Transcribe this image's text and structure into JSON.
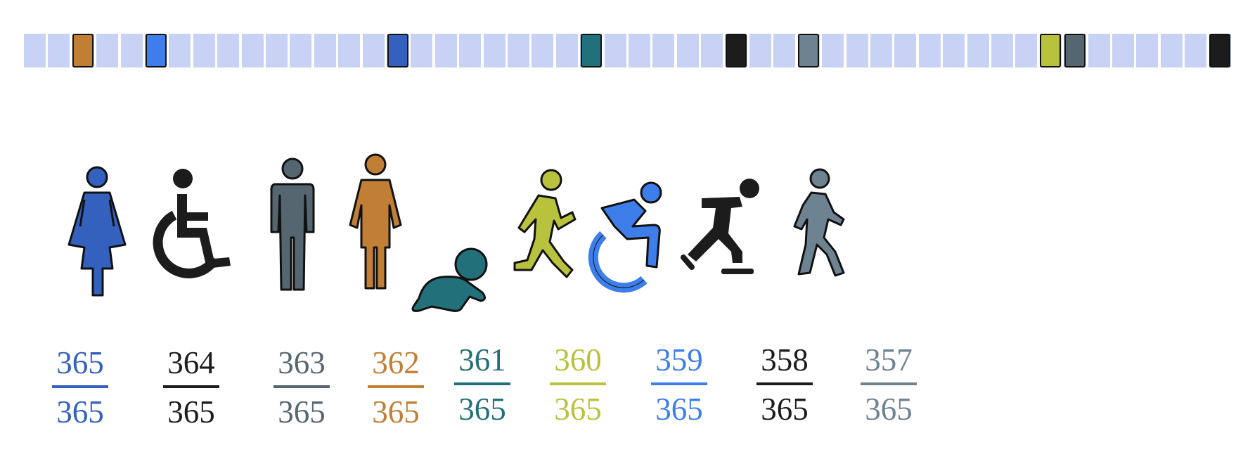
{
  "timeline": {
    "cell_count": 50,
    "cell_color": "#c7d2f4",
    "markers": [
      {
        "index": 2,
        "color": "#c07f35"
      },
      {
        "index": 5,
        "color": "#3d7eeb"
      },
      {
        "index": 15,
        "color": "#3461be"
      },
      {
        "index": 23,
        "color": "#22707a"
      },
      {
        "index": 29,
        "color": "#1c1c1c"
      },
      {
        "index": 32,
        "color": "#6e8391"
      },
      {
        "index": 42,
        "color": "#b9c23d"
      },
      {
        "index": 43,
        "color": "#566670"
      },
      {
        "index": 49,
        "color": "#1c1c1c"
      }
    ]
  },
  "figures": [
    {
      "icon": "woman-icon",
      "color": "#3461be",
      "numerator": "365",
      "denominator": "365"
    },
    {
      "icon": "wheelchair-icon",
      "color": "#1c1c1c",
      "numerator": "364",
      "denominator": "365"
    },
    {
      "icon": "man-icon",
      "color": "#566670",
      "numerator": "363",
      "denominator": "365"
    },
    {
      "icon": "person-in-dress-icon",
      "color": "#c07f35",
      "numerator": "362",
      "denominator": "365"
    },
    {
      "icon": "crawling-baby-icon",
      "color": "#22707a",
      "numerator": "361",
      "denominator": "365"
    },
    {
      "icon": "running-child-icon",
      "color": "#b9c23d",
      "numerator": "360",
      "denominator": "365"
    },
    {
      "icon": "active-wheelchair-icon",
      "color": "#3d7eeb",
      "numerator": "359",
      "denominator": "365"
    },
    {
      "icon": "ice-skater-icon",
      "color": "#1c1c1c",
      "numerator": "358",
      "denominator": "365"
    },
    {
      "icon": "walking-person-icon",
      "color": "#6e8391",
      "numerator": "357",
      "denominator": "365"
    }
  ]
}
